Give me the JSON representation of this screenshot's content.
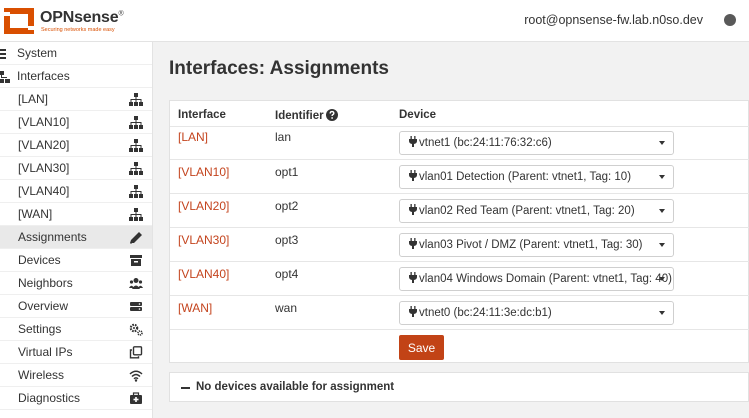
{
  "brand": {
    "name": "OPNsense",
    "registered_mark": "®",
    "tagline": "Securing networks made easy",
    "accent": "#d94f00"
  },
  "header": {
    "user": "root@opnsense-fw.lab.n0so.dev"
  },
  "sidebar": {
    "system_label": "System",
    "interfaces_label": "Interfaces",
    "items": [
      {
        "label": "[LAN]",
        "icon": "sitemap-icon"
      },
      {
        "label": "[VLAN10]",
        "icon": "sitemap-icon"
      },
      {
        "label": "[VLAN20]",
        "icon": "sitemap-icon"
      },
      {
        "label": "[VLAN30]",
        "icon": "sitemap-icon"
      },
      {
        "label": "[VLAN40]",
        "icon": "sitemap-icon"
      },
      {
        "label": "[WAN]",
        "icon": "sitemap-icon"
      },
      {
        "label": "Assignments",
        "icon": "pencil-icon",
        "active": true
      },
      {
        "label": "Devices",
        "icon": "archive-icon"
      },
      {
        "label": "Neighbors",
        "icon": "users-icon"
      },
      {
        "label": "Overview",
        "icon": "server-icon"
      },
      {
        "label": "Settings",
        "icon": "cogs-icon"
      },
      {
        "label": "Virtual IPs",
        "icon": "clone-icon"
      },
      {
        "label": "Wireless",
        "icon": "wifi-icon"
      },
      {
        "label": "Diagnostics",
        "icon": "medkit-icon"
      }
    ]
  },
  "main": {
    "title": "Interfaces: Assignments",
    "columns": {
      "interface": "Interface",
      "identifier": "Identifier",
      "device": "Device"
    },
    "rows": [
      {
        "interface": "[LAN]",
        "identifier": "lan",
        "device": "vtnet1 (bc:24:11:76:32:c6)"
      },
      {
        "interface": "[VLAN10]",
        "identifier": "opt1",
        "device": "vlan01 Detection (Parent: vtnet1, Tag: 10)"
      },
      {
        "interface": "[VLAN20]",
        "identifier": "opt2",
        "device": "vlan02 Red Team (Parent: vtnet1, Tag: 20)"
      },
      {
        "interface": "[VLAN30]",
        "identifier": "opt3",
        "device": "vlan03 Pivot / DMZ (Parent: vtnet1, Tag: 30)"
      },
      {
        "interface": "[VLAN40]",
        "identifier": "opt4",
        "device": "vlan04 Windows Domain (Parent: vtnet1, Tag: 40)"
      },
      {
        "interface": "[WAN]",
        "identifier": "wan",
        "device": "vtnet0 (bc:24:11:3e:dc:b1)"
      }
    ],
    "save_label": "Save",
    "no_devices": "No devices available for assignment"
  }
}
